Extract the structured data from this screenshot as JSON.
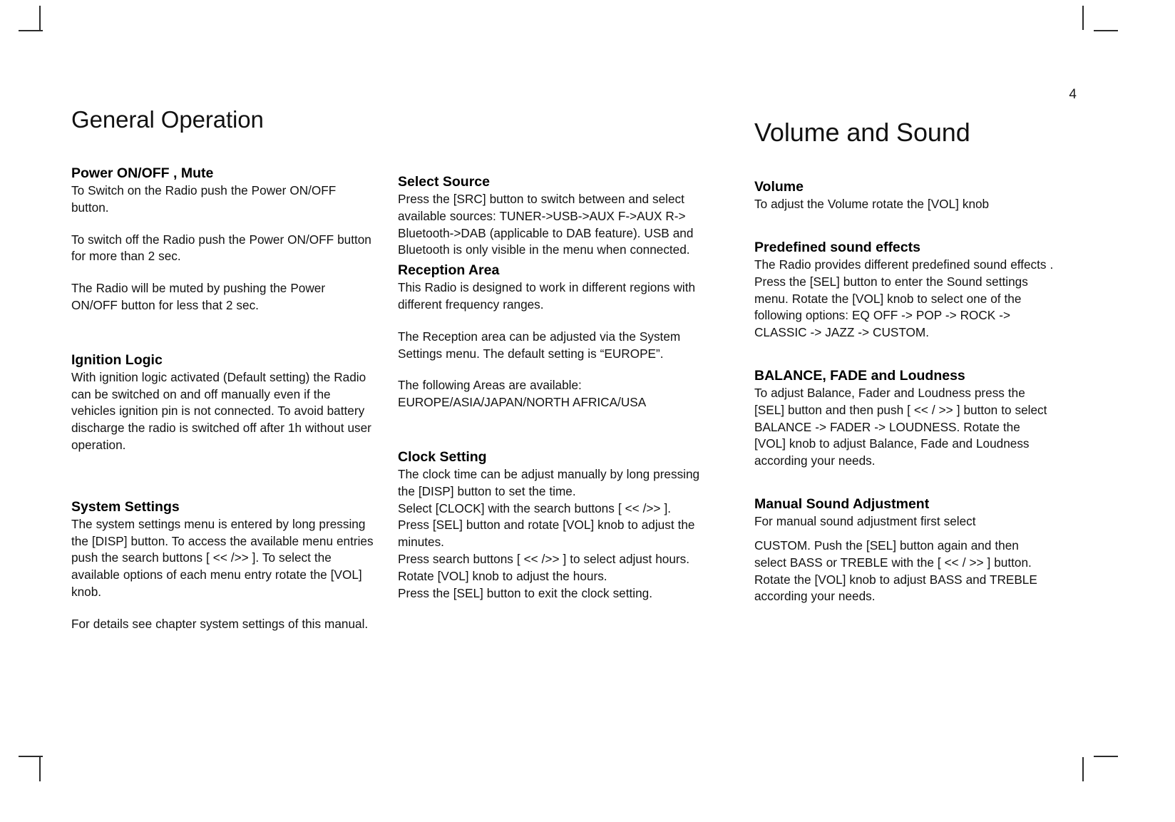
{
  "page": {
    "number": "4"
  },
  "columns": [
    {
      "id": "general-operation",
      "title": "General Operation",
      "sections": [
        {
          "heading": "Power ON/OFF , Mute",
          "paragraphs": [
            "To Switch on the Radio push the Power ON/OFF button.",
            "To switch off the Radio push the Power ON/OFF button for more than 2 sec.",
            "The Radio will be muted by pushing the Power ON/OFF button for less that 2 sec."
          ]
        },
        {
          "heading": "Ignition Logic",
          "paragraphs": [
            "With ignition logic activated (Default setting) the Radio can be switched on and off manually even if the vehicles ignition pin is not connected. To avoid battery discharge the radio is switched off after 1h without user operation."
          ]
        },
        {
          "heading": "System Settings",
          "paragraphs": [
            "The system settings menu is entered by long pressing the [DISP] button. To access the available menu entries push the search  buttons [ << />> ]. To select the available options of each menu entry rotate the [VOL] knob.",
            "For details see chapter system settings of this manual."
          ]
        }
      ]
    },
    {
      "id": "select-source",
      "title": "",
      "sections": [
        {
          "heading": "Select Source",
          "paragraphs": [
            "Press the [SRC] button to switch between and select available sources: TUNER->USB->AUX F->AUX R-> Bluetooth->DAB (applicable to DAB feature). USB and Bluetooth is only visible in the menu when connected."
          ]
        },
        {
          "heading": "Reception Area",
          "paragraphs": [
            "This Radio is  designed to work in different regions with different frequency  ranges.",
            "The Reception area can be adjusted via the System Settings menu. The default setting is “EUROPE”.",
            "The following Areas are available: EUROPE/ASIA/JAPAN/NORTH AFRICA/USA"
          ]
        },
        {
          "heading": "Clock Setting",
          "paragraphs": [
            "The clock time can be adjust manually by long pressing the [DISP] button to set the time.",
            "Select  [CLOCK]  with  the  search  buttons [ << />> ].",
            "Press [SEL] button and rotate [VOL] knob to adjust the minutes.",
            "Press search  buttons [ << />> ] to select adjust hours. Rotate [VOL] knob to adjust the hours.",
            "Press the [SEL] button to exit the clock setting."
          ]
        }
      ]
    },
    {
      "id": "volume-and-sound",
      "title": "Volume and Sound",
      "sections": [
        {
          "heading": "Volume",
          "paragraphs": [
            "To adjust the Volume rotate the [VOL] knob"
          ]
        },
        {
          "heading": "Predefined sound effects",
          "paragraphs": [
            "The Radio provides different predefined sound effects .",
            "Press the [SEL] button to enter the Sound settings menu. Rotate the [VOL] knob to select one of the following options: EQ OFF -> POP -> ROCK -> CLASSIC -> JAZZ  -> CUSTOM."
          ]
        },
        {
          "heading": "BALANCE, FADE and Loudness",
          "paragraphs": [
            "To adjust Balance, Fader and Loudness press the [SEL] button and then push [ << / >> ] button to select BALANCE -> FADER -> LOUDNESS. Rotate the [VOL] knob to adjust  Balance, Fade and Loudness according your needs."
          ]
        },
        {
          "heading": "Manual Sound Adjustment",
          "paragraphs": [
            "For manual sound adjustment first select",
            "CUSTOM. Push the [SEL] button again and then select BASS  or TREBLE with the [ << / >> ]  button. Rotate the [VOL] knob to adjust  BASS and TREBLE according your needs."
          ]
        }
      ]
    }
  ]
}
